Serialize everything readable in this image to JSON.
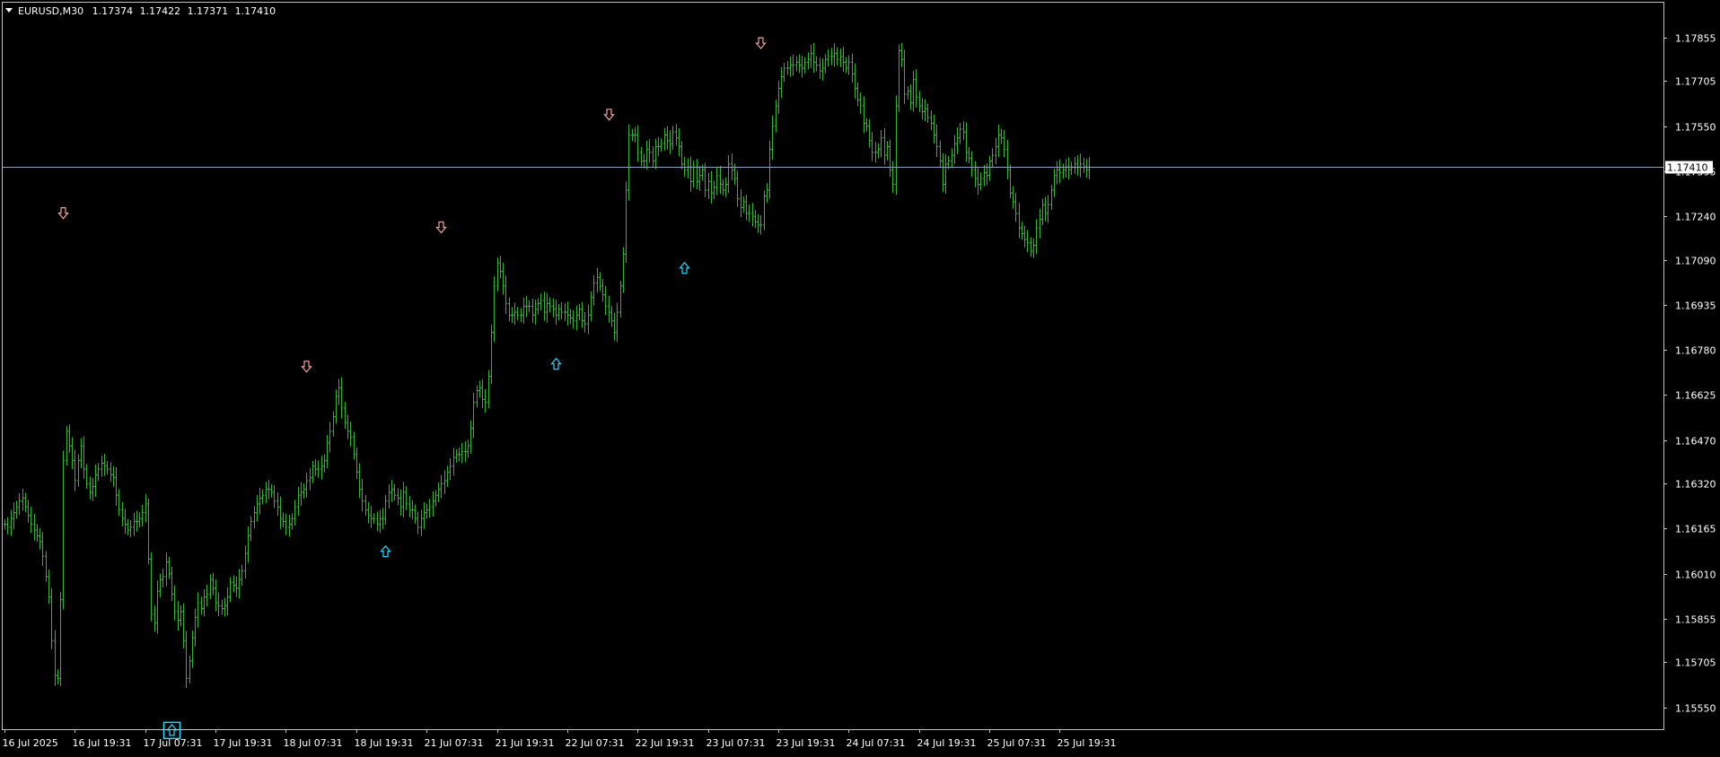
{
  "header": {
    "symbol": "EURUSD,M30",
    "open": "1.17374",
    "high": "1.17422",
    "low": "1.17371",
    "close": "1.17410",
    "menu_icon": "triangle-down-icon"
  },
  "colors": {
    "background": "#000000",
    "border": "#c0c0c0",
    "bars": "#2fb52f",
    "text": "#ffffff",
    "price_line": "#8aa2b4",
    "sell_arrow": "#f4a0a0",
    "buy_arrow": "#22d8ff"
  },
  "chart_data": {
    "type": "ohlc",
    "symbol": "EURUSD",
    "timeframe": "M30",
    "ylim": [
      1.15475,
      1.17975
    ],
    "y_ticks": [
      "1.17855",
      "1.17705",
      "1.17550",
      "1.17395",
      "1.17240",
      "1.17090",
      "1.16935",
      "1.16780",
      "1.16625",
      "1.16470",
      "1.16320",
      "1.16165",
      "1.16010",
      "1.15855",
      "1.15705",
      "1.15550"
    ],
    "current_price": "1.17410",
    "x_ticks": [
      {
        "label": "16 Jul 2025",
        "bar": 0
      },
      {
        "label": "16 Jul 19:31",
        "bar": 24
      },
      {
        "label": "17 Jul 07:31",
        "bar": 48
      },
      {
        "label": "17 Jul 19:31",
        "bar": 72
      },
      {
        "label": "18 Jul 07:31",
        "bar": 96
      },
      {
        "label": "18 Jul 19:31",
        "bar": 120
      },
      {
        "label": "21 Jul 07:31",
        "bar": 144
      },
      {
        "label": "21 Jul 19:31",
        "bar": 168
      },
      {
        "label": "22 Jul 07:31",
        "bar": 192
      },
      {
        "label": "22 Jul 19:31",
        "bar": 216
      },
      {
        "label": "23 Jul 07:31",
        "bar": 240
      },
      {
        "label": "23 Jul 19:31",
        "bar": 264
      },
      {
        "label": "24 Jul 07:31",
        "bar": 288
      },
      {
        "label": "24 Jul 19:31",
        "bar": 312
      },
      {
        "label": "25 Jul 07:31",
        "bar": 336
      },
      {
        "label": "25 Jul 19:31",
        "bar": 360
      }
    ],
    "total_bars": 371,
    "closes": [
      1.1618,
      1.1617,
      1.162,
      1.1622,
      1.1624,
      1.1626,
      1.1627,
      1.1624,
      1.1621,
      1.1618,
      1.1616,
      1.1614,
      1.1612,
      1.1607,
      1.16,
      1.1593,
      1.1578,
      1.1566,
      1.1565,
      1.1592,
      1.164,
      1.165,
      1.1645,
      1.164,
      1.1633,
      1.164,
      1.1645,
      1.1637,
      1.1632,
      1.1629,
      1.1631,
      1.1635,
      1.1637,
      1.1639,
      1.1638,
      1.1637,
      1.1635,
      1.1634,
      1.1628,
      1.1623,
      1.162,
      1.1618,
      1.1616,
      1.1617,
      1.1619,
      1.1619,
      1.162,
      1.1622,
      1.1625,
      1.1606,
      1.1587,
      1.1584,
      1.1595,
      1.1599,
      1.16,
      1.1605,
      1.1601,
      1.1594,
      1.1588,
      1.1585,
      1.1588,
      1.1578,
      1.1565,
      1.1571,
      1.1579,
      1.1586,
      1.1591,
      1.1589,
      1.1593,
      1.1594,
      1.1599,
      1.1596,
      1.1591,
      1.159,
      1.1589,
      1.159,
      1.1593,
      1.1598,
      1.1597,
      1.1596,
      1.1599,
      1.1602,
      1.1608,
      1.1614,
      1.1619,
      1.1622,
      1.1625,
      1.1627,
      1.1628,
      1.163,
      1.163,
      1.1629,
      1.1626,
      1.1624,
      1.162,
      1.1619,
      1.1617,
      1.1618,
      1.162,
      1.1624,
      1.1628,
      1.1629,
      1.163,
      1.1633,
      1.1634,
      1.1638,
      1.1637,
      1.1637,
      1.1638,
      1.164,
      1.1646,
      1.165,
      1.1655,
      1.1662,
      1.1665,
      1.1658,
      1.1653,
      1.165,
      1.1648,
      1.1642,
      1.1636,
      1.163,
      1.1626,
      1.1623,
      1.1621,
      1.162,
      1.162,
      1.1618,
      1.162,
      1.162,
      1.1626,
      1.1629,
      1.163,
      1.1628,
      1.1627,
      1.1624,
      1.1629,
      1.1625,
      1.1623,
      1.1623,
      1.162,
      1.1617,
      1.162,
      1.1622,
      1.1623,
      1.1624,
      1.1626,
      1.1628,
      1.163,
      1.1632,
      1.1633,
      1.1636,
      1.1638,
      1.1641,
      1.1642,
      1.1642,
      1.1643,
      1.1643,
      1.1645,
      1.1651,
      1.166,
      1.1664,
      1.1665,
      1.1661,
      1.166,
      1.1669,
      1.1684,
      1.17,
      1.1708,
      1.1705,
      1.17,
      1.1694,
      1.169,
      1.169,
      1.1691,
      1.169,
      1.169,
      1.1693,
      1.1693,
      1.1693,
      1.169,
      1.1692,
      1.1694,
      1.1695,
      1.1691,
      1.1694,
      1.1693,
      1.1692,
      1.169,
      1.1692,
      1.1691,
      1.1691,
      1.169,
      1.1689,
      1.1688,
      1.169,
      1.1692,
      1.1688,
      1.1687,
      1.169,
      1.1696,
      1.1701,
      1.1703,
      1.17,
      1.1697,
      1.1693,
      1.1691,
      1.1688,
      1.1684,
      1.1691,
      1.17,
      1.1711,
      1.1733,
      1.1752,
      1.1752,
      1.1752,
      1.1746,
      1.1743,
      1.1743,
      1.1747,
      1.1746,
      1.1743,
      1.1748,
      1.1748,
      1.1749,
      1.1752,
      1.175,
      1.1749,
      1.1753,
      1.1751,
      1.1748,
      1.1742,
      1.174,
      1.1741,
      1.1736,
      1.1741,
      1.1736,
      1.1738,
      1.174,
      1.1733,
      1.1736,
      1.1732,
      1.1734,
      1.1738,
      1.1735,
      1.1733,
      1.1735,
      1.1742,
      1.174,
      1.1737,
      1.173,
      1.1727,
      1.1729,
      1.1725,
      1.1725,
      1.1724,
      1.1722,
      1.1721,
      1.1721,
      1.1731,
      1.1733,
      1.1747,
      1.1755,
      1.1762,
      1.1768,
      1.1772,
      1.1775,
      1.1775,
      1.1776,
      1.1776,
      1.1777,
      1.1776,
      1.1775,
      1.1777,
      1.1778,
      1.178,
      1.1777,
      1.1776,
      1.1774,
      1.1775,
      1.1778,
      1.1779,
      1.1779,
      1.178,
      1.1778,
      1.1779,
      1.1777,
      1.1775,
      1.1777,
      1.1773,
      1.1768,
      1.1764,
      1.1762,
      1.1756,
      1.1755,
      1.175,
      1.1746,
      1.1746,
      1.1747,
      1.1751,
      1.1745,
      1.1748,
      1.174,
      1.1735,
      1.1762,
      1.1781,
      1.1778,
      1.1766,
      1.1767,
      1.1763,
      1.1771,
      1.1765,
      1.1762,
      1.176,
      1.1761,
      1.1758,
      1.1756,
      1.1752,
      1.1748,
      1.1743,
      1.1735,
      1.1742,
      1.1743,
      1.1745,
      1.1749,
      1.1751,
      1.1754,
      1.1753,
      1.1746,
      1.1744,
      1.174,
      1.1737,
      1.1735,
      1.1737,
      1.1739,
      1.1738,
      1.1743,
      1.1745,
      1.1748,
      1.1752,
      1.1751,
      1.1747,
      1.174,
      1.1732,
      1.1729,
      1.1725,
      1.172,
      1.1718,
      1.1716,
      1.1715,
      1.1712,
      1.1714,
      1.172,
      1.1723,
      1.1728,
      1.1725,
      1.1728,
      1.1733,
      1.1738,
      1.174,
      1.1739,
      1.174,
      1.1741,
      1.174,
      1.1741,
      1.1742,
      1.1741,
      1.1742,
      1.1741,
      1.174,
      1.1741
    ],
    "signals": [
      {
        "type": "sell",
        "bar": 20,
        "price": 1.17223
      },
      {
        "type": "buy",
        "bar": 57,
        "price": 1.155,
        "boxed": true
      },
      {
        "type": "sell",
        "bar": 103,
        "price": 1.16695
      },
      {
        "type": "buy",
        "bar": 130,
        "price": 1.16115
      },
      {
        "type": "sell",
        "bar": 149,
        "price": 1.17174
      },
      {
        "type": "buy",
        "bar": 188,
        "price": 1.1676
      },
      {
        "type": "sell",
        "bar": 206,
        "price": 1.17562
      },
      {
        "type": "buy",
        "bar": 232,
        "price": 1.1709
      },
      {
        "type": "sell",
        "bar": 258,
        "price": 1.17808
      }
    ]
  }
}
